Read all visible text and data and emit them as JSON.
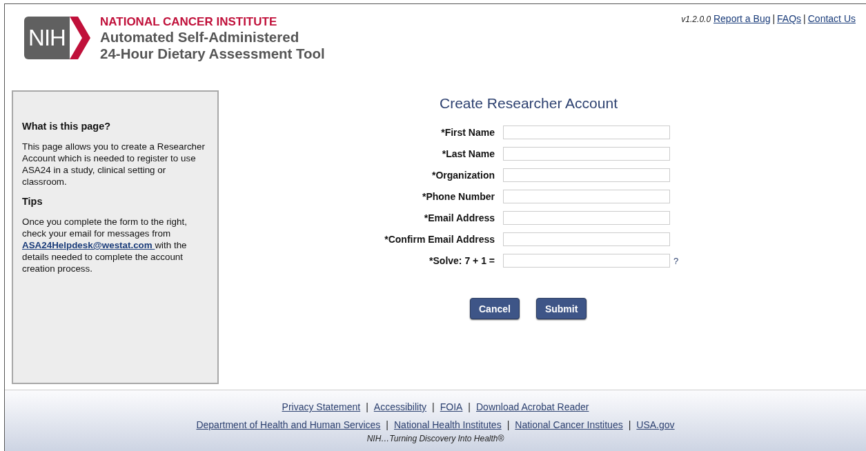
{
  "header": {
    "logo_text": "NIH",
    "institute": "NATIONAL CANCER INSTITUTE",
    "title_lines": [
      "Automated Self-Administered",
      "24-Hour Dietary Assessment Tool"
    ],
    "version": "v1.2.0.0",
    "top_links": [
      {
        "kind": "link",
        "text": "Report a Bug"
      },
      {
        "kind": "separator",
        "text": "|"
      },
      {
        "kind": "link",
        "text": "FAQs"
      },
      {
        "kind": "separator",
        "text": "|"
      },
      {
        "kind": "link",
        "text": "Contact Us"
      }
    ]
  },
  "sidebar": {
    "heading": "What is this page?",
    "intro": "This page allows you to create a Researcher Account which is needed to register to use ASA24 in a study, clinical setting or classroom.",
    "tips_heading": "Tips",
    "tips_before": "Once you complete the form to the right, check your email for messages from ",
    "tips_link": "ASA24Helpdesk@westat.com ",
    "tips_after": "with the details needed to complete the account creation process."
  },
  "form": {
    "title": "Create Researcher Account",
    "fields": [
      {
        "label": "*First Name"
      },
      {
        "label": "*Last Name"
      },
      {
        "label": "*Organization"
      },
      {
        "label": "*Phone Number"
      },
      {
        "label": "*Email Address"
      },
      {
        "label": "*Confirm Email Address"
      },
      {
        "label": "*Solve: 7 + 1 =",
        "help": "?"
      }
    ],
    "buttons": [
      "Cancel",
      "Submit"
    ]
  },
  "footer": {
    "primary_links": [
      {
        "kind": "link",
        "text": "Privacy Statement"
      },
      {
        "kind": "separator",
        "text": "|"
      },
      {
        "kind": "link",
        "text": "Accessibility"
      },
      {
        "kind": "separator",
        "text": "|"
      },
      {
        "kind": "link",
        "text": "FOIA"
      },
      {
        "kind": "separator",
        "text": "|"
      },
      {
        "kind": "link",
        "text": "Download Acrobat Reader"
      }
    ],
    "secondary_links": [
      {
        "kind": "link",
        "text": "Department of Health and Human Services"
      },
      {
        "kind": "separator",
        "text": "|"
      },
      {
        "kind": "link",
        "text": "National Health Institutes"
      },
      {
        "kind": "separator",
        "text": "|"
      },
      {
        "kind": "link",
        "text": "National Cancer Institues"
      },
      {
        "kind": "separator",
        "text": "|"
      },
      {
        "kind": "link",
        "text": "USA.gov"
      }
    ],
    "tagline": "NIH…Turning Discovery Into Health®"
  }
}
